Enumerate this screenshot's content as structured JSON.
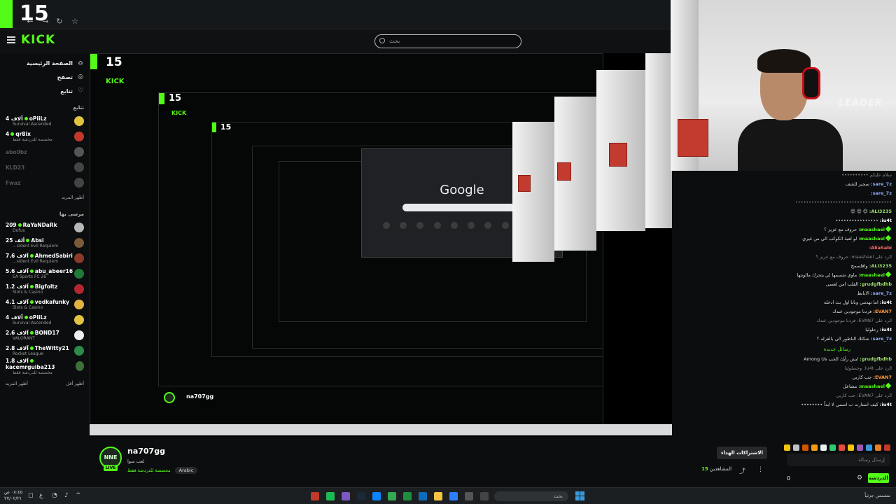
{
  "browser": {
    "tab_number": "15"
  },
  "header": {
    "logo": "KICK",
    "search_placeholder": "بحث"
  },
  "sidebar": {
    "nav": [
      {
        "label": "الصفحة الرئيسية",
        "icon": "home-icon"
      },
      {
        "label": "تصفح",
        "icon": "compass-icon"
      },
      {
        "label": "تتابع",
        "icon": "heart-icon"
      }
    ],
    "following_label": "تتابع",
    "following": [
      {
        "name": "oPiiLz",
        "count": "4 آلاف",
        "sub": "Survival Ascended",
        "avatar_color": "#e0c341",
        "online": true
      },
      {
        "name": "qr8ix",
        "count": "4",
        "sub": "مخصصة للدردشة فقط",
        "avatar_color": "#c0392b",
        "online": true
      },
      {
        "name": "abo0bz",
        "count": "",
        "sub": "",
        "avatar_color": "#555555",
        "online": false
      },
      {
        "name": "KLD23",
        "count": "",
        "sub": "",
        "avatar_color": "#444444",
        "online": false
      },
      {
        "name": "Fwaz",
        "count": "",
        "sub": "",
        "avatar_color": "#444444",
        "online": false
      }
    ],
    "show_more": "أظهر المزيد",
    "recommended_label": "مرسى بها",
    "recommended": [
      {
        "name": "RaYaNDaRk",
        "count": "209",
        "sub": "Dofus",
        "avatar_color": "#b7b7b7"
      },
      {
        "name": "Absi",
        "count": "25 ألف",
        "sub": "...sident Evil Requiem",
        "avatar_color": "#7a5a3a"
      },
      {
        "name": "AhmedSabiri",
        "count": "7.6 آلاف",
        "sub": "...sident Evil Requiem",
        "avatar_color": "#8b3a2a"
      },
      {
        "name": "abu_abeer16",
        "count": "5.6 آلاف",
        "sub": "EA Sports FC 26",
        "avatar_color": "#1f7a3a"
      },
      {
        "name": "Bigfoltz",
        "count": "1.2 آلاف",
        "sub": "Slots & Casino",
        "avatar_color": "#b3262e"
      },
      {
        "name": "vodkafunky",
        "count": "4.1 آلاف",
        "sub": "Slots & Casino",
        "avatar_color": "#e0b341"
      },
      {
        "name": "oPiiLz",
        "count": "4 آلاف",
        "sub": "Survival Ascended",
        "avatar_color": "#e0c341"
      },
      {
        "name": "BOND17",
        "count": "2.6 آلاف",
        "sub": "VALORANT",
        "avatar_color": "#eeeeee"
      },
      {
        "name": "TheWitty21",
        "count": "2.8 آلاف",
        "sub": "Rocket League",
        "avatar_color": "#2c8a4a"
      },
      {
        "name": "kacemrguiba213",
        "count": "1.8 آلاف",
        "sub": "مخصصة للدردشة فقط",
        "avatar_color": "#3f6f3a"
      }
    ],
    "show_more_bottom": "أظهر المزيد",
    "show_less": "أظهر أقل"
  },
  "stream_preview": {
    "google_word": "Google"
  },
  "webcam": {
    "overlay_text": "LEADER"
  },
  "chat": {
    "messages": [
      {
        "user": "",
        "text": "سلام عليكم ••••••••••"
      },
      {
        "user": "sare_7z:",
        "text": "سجير للشف",
        "color": "#8fb0ff"
      },
      {
        "user": "sare_7z:",
        "text": "",
        "color": "#8fb0ff"
      },
      {
        "user": "",
        "text": "••••••••••••••••••••••••••••••••••••"
      },
      {
        "user": "ALI3235:",
        "text": "😊 😊 😊",
        "color": "#9ee06f"
      },
      {
        "user": "iu4t:",
        "text": "••••••••••••••••",
        "color": "#ffffff"
      },
      {
        "user": "maashael:",
        "text": "حروف مع عزيز ؟",
        "color": "#53fc18",
        "mark": true
      },
      {
        "user": "maashael:",
        "text": "لو لعبة الكوكب الي من غيري",
        "color": "#53fc18",
        "mark": true
      },
      {
        "user": "AliaSabi:",
        "text": "",
        "color": "#ff6b6b"
      },
      {
        "user": "",
        "text": "الرد على maashael: حروف مع عزيز ؟"
      },
      {
        "user": "ALI3235:",
        "text": "واقلسمح",
        "color": "#9ee06f"
      },
      {
        "user": "maashael:",
        "text": "ماوي شسمها لي يتحرك مالونتها",
        "color": "#53fc18",
        "mark": true
      },
      {
        "user": "grudgfbdhb:",
        "text": "القلب امن لعسى",
        "color": "#9ee06f"
      },
      {
        "user": "sare_7z:",
        "text": "الابانط",
        "color": "#8fb0ff"
      },
      {
        "user": "iu4t:",
        "text": "اما تهدتني ونانا اول بث ادخله",
        "color": "#ffffff"
      },
      {
        "user": "EVAN7:",
        "text": "فردنا موجودين عندك",
        "color": "#ff9a3c"
      },
      {
        "user": "",
        "text": "الرد على EVAN7: فردنا موجودين عندك"
      },
      {
        "user": "iu4t:",
        "text": "رحلوليا",
        "color": "#ffffff"
      },
      {
        "user": "sare_7z:",
        "text": "شكلك الناطور الي بالغرله ؟",
        "color": "#8fb0ff"
      }
    ],
    "new_messages_label": "رسائل جديدة",
    "tail": [
      {
        "user": "grudgfbdhb:",
        "text": "ايش رأيك الحب Among Us",
        "color": "#9ee06f"
      },
      {
        "user": "",
        "text": "الرد على iu4t: وحسلوليا"
      },
      {
        "user": "EVAN7:",
        "text": "جب كاربي",
        "color": "#ff9a3c"
      },
      {
        "user": "maashael:",
        "text": "مشاعل",
        "color": "#53fc18",
        "mark": true
      },
      {
        "user": "",
        "text": "الرد على EVAN7: جب كاربي"
      },
      {
        "user": "iu4t:",
        "text": "كيف استارت ب اسمي لا ابداً ••••••••",
        "color": "#ffffff"
      }
    ],
    "input_placeholder": "إرسال رسالة",
    "send_label": "الدردشة",
    "user_count": "0"
  },
  "streamer": {
    "name": "na707gg",
    "avatar_text": "NNE",
    "live": "LIVE",
    "category": "لعب سوا",
    "chat_category": "مخصصة للدردشة فقط",
    "language_tag": "Arabic",
    "subscribe_label": "الاشتراكات الهداء",
    "viewers_label": "المشاهدين",
    "viewers_count": "15"
  },
  "taskbar": {
    "search_placeholder": "بحث",
    "time": "٠٨:٤٥ ص",
    "date": "٢٧/٠٢/٢١",
    "tray_right": "مشمس جزئياً"
  },
  "colors": {
    "kick_green": "#53fc18",
    "background": "#0b0d0e"
  }
}
